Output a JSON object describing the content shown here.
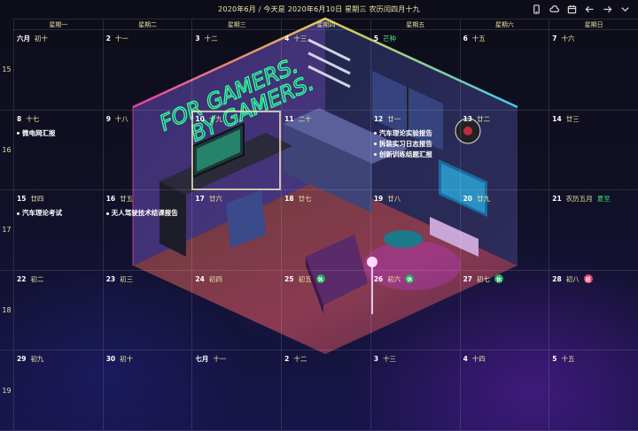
{
  "header": {
    "title": "2020年6月 / 今天是 2020年6月10日 星期三 农历闰四月十九"
  },
  "toolbar": [
    {
      "name": "phone-icon"
    },
    {
      "name": "cloud-icon"
    },
    {
      "name": "calendar-icon"
    },
    {
      "name": "arrow-left-icon"
    },
    {
      "name": "arrow-right-icon"
    },
    {
      "name": "chevron-down-icon"
    }
  ],
  "weekdays": [
    "星期一",
    "星期二",
    "星期三",
    "星期四",
    "星期五",
    "星期六",
    "星期日"
  ],
  "weeks": [
    "15",
    "16",
    "17",
    "18",
    "19"
  ],
  "wallpaper": {
    "neon_line_1": "FOR GAMERS.",
    "neon_line_2": "BY GAMERS."
  },
  "colors": {
    "accent_text": "#f1e6a6",
    "rest_badge": "#1fae5c",
    "work_badge": "#e8416a",
    "solar_term": "#36d96a"
  },
  "cells": [
    {
      "day": "六月",
      "lunar": "初十",
      "events": []
    },
    {
      "day": "2",
      "lunar": "十一",
      "events": []
    },
    {
      "day": "3",
      "lunar": "十二",
      "events": []
    },
    {
      "day": "4",
      "lunar": "十三",
      "events": []
    },
    {
      "day": "5",
      "lunar": "芒种",
      "lunar_class": "green",
      "events": []
    },
    {
      "day": "6",
      "lunar": "十五",
      "events": []
    },
    {
      "day": "7",
      "lunar": "十六",
      "events": []
    },
    {
      "day": "8",
      "lunar": "十七",
      "events": [
        "微电网汇报"
      ]
    },
    {
      "day": "9",
      "lunar": "十八",
      "events": []
    },
    {
      "day": "10",
      "lunar": "十九",
      "today": true,
      "events": []
    },
    {
      "day": "11",
      "lunar": "二十",
      "events": []
    },
    {
      "day": "12",
      "lunar": "廿一",
      "events": [
        "汽车理论实验报告",
        "拆装实习日志报告",
        "创新训练结题汇报"
      ]
    },
    {
      "day": "13",
      "lunar": "廿二",
      "events": []
    },
    {
      "day": "14",
      "lunar": "廿三",
      "events": []
    },
    {
      "day": "15",
      "lunar": "廿四",
      "events": [
        "汽车理论考试"
      ]
    },
    {
      "day": "16",
      "lunar": "廿五",
      "events": [
        "无人驾驶技术结课报告"
      ]
    },
    {
      "day": "17",
      "lunar": "廿六",
      "events": []
    },
    {
      "day": "18",
      "lunar": "廿七",
      "events": []
    },
    {
      "day": "19",
      "lunar": "廿八",
      "events": []
    },
    {
      "day": "20",
      "lunar": "廿九",
      "events": []
    },
    {
      "day": "21",
      "lunar": "农历五月",
      "term": "夏至",
      "events": []
    },
    {
      "day": "22",
      "lunar": "初二",
      "events": []
    },
    {
      "day": "23",
      "lunar": "初三",
      "events": []
    },
    {
      "day": "24",
      "lunar": "初四",
      "events": []
    },
    {
      "day": "25",
      "lunar": "初五",
      "badge": "休",
      "badge_type": "rest",
      "events": []
    },
    {
      "day": "26",
      "lunar": "初六",
      "badge": "休",
      "badge_type": "rest",
      "events": []
    },
    {
      "day": "27",
      "lunar": "初七",
      "badge": "休",
      "badge_type": "rest",
      "events": []
    },
    {
      "day": "28",
      "lunar": "初八",
      "badge": "班",
      "badge_type": "work",
      "events": []
    },
    {
      "day": "29",
      "lunar": "初九",
      "events": []
    },
    {
      "day": "30",
      "lunar": "初十",
      "events": []
    },
    {
      "day": "七月",
      "lunar": "十一",
      "events": []
    },
    {
      "day": "2",
      "lunar": "十二",
      "events": []
    },
    {
      "day": "3",
      "lunar": "十三",
      "events": []
    },
    {
      "day": "4",
      "lunar": "十四",
      "events": []
    },
    {
      "day": "5",
      "lunar": "十五",
      "events": []
    }
  ]
}
